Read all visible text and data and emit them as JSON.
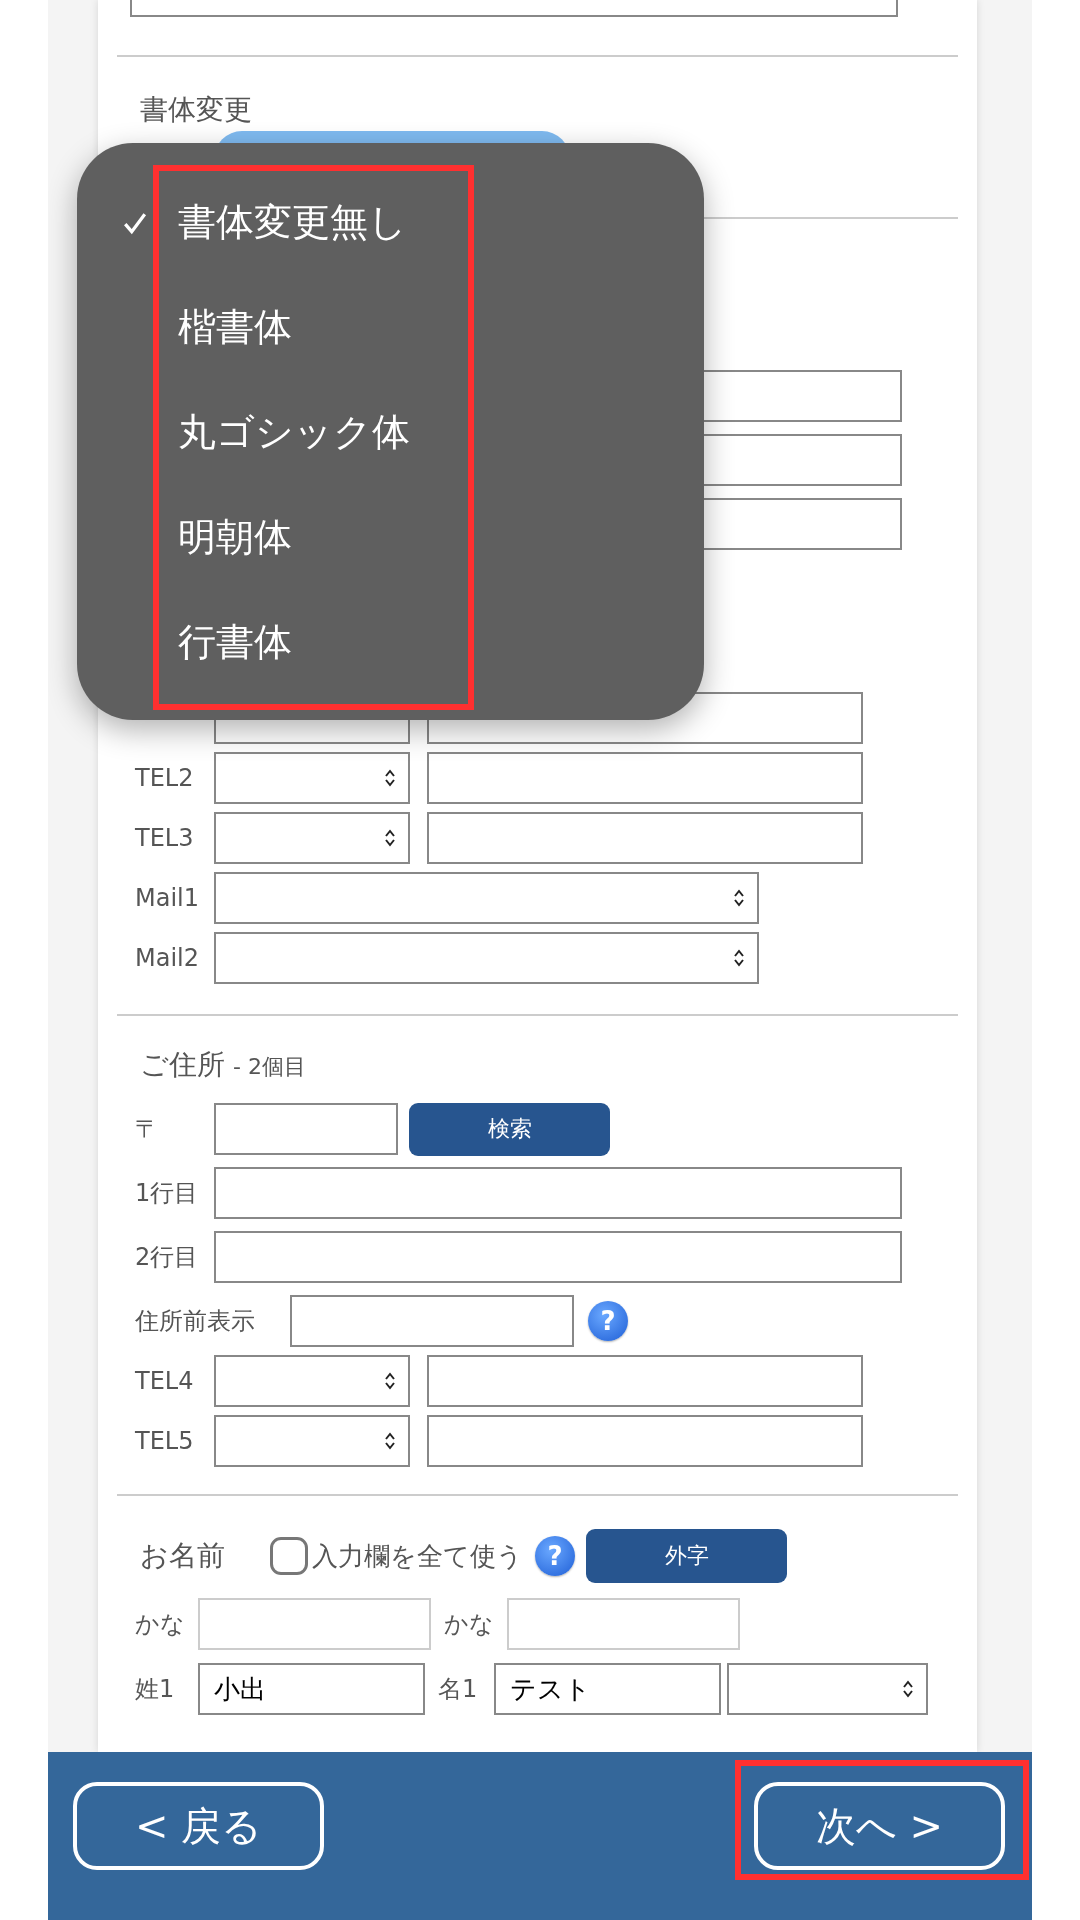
{
  "font_section": {
    "label": "書体変更"
  },
  "font_menu": {
    "highlighted": true,
    "options": [
      {
        "label": "書体変更無し",
        "selected": true
      },
      {
        "label": "楷書体",
        "selected": false
      },
      {
        "label": "丸ゴシック体",
        "selected": false
      },
      {
        "label": "明朝体",
        "selected": false
      },
      {
        "label": "行書体",
        "selected": false
      }
    ]
  },
  "phone_rows": [
    {
      "kind": "tel",
      "covered": true
    },
    {
      "kind": "tel",
      "label": "TEL2"
    },
    {
      "kind": "tel",
      "label": "TEL3"
    },
    {
      "kind": "mail",
      "label": "Mail1"
    },
    {
      "kind": "mail",
      "label": "Mail2"
    }
  ],
  "address2": {
    "title": "ご住所",
    "subtitle": "- 2個目",
    "postal_label": "〒",
    "search_button": "検索",
    "rows": [
      {
        "kind": "wide",
        "label": "1行目"
      },
      {
        "kind": "wide",
        "label": "2行目"
      },
      {
        "kind": "prefix",
        "label": "住所前表示",
        "help": "?"
      },
      {
        "kind": "tel",
        "label": "TEL4"
      },
      {
        "kind": "tel",
        "label": "TEL5"
      }
    ]
  },
  "name_section": {
    "title": "お名前",
    "use_all_fields": {
      "label": "入力欄を全て使う",
      "checked": false
    },
    "help": "?",
    "gaiji_button": "外字",
    "kana_labels": [
      "かな",
      "かな"
    ],
    "surname": {
      "label": "姓1",
      "value": "小出"
    },
    "given_name": {
      "label": "名1",
      "value": "テスト"
    }
  },
  "footer": {
    "back_button": "< 戻る",
    "next_button": "次へ >",
    "next_highlighted": true
  }
}
